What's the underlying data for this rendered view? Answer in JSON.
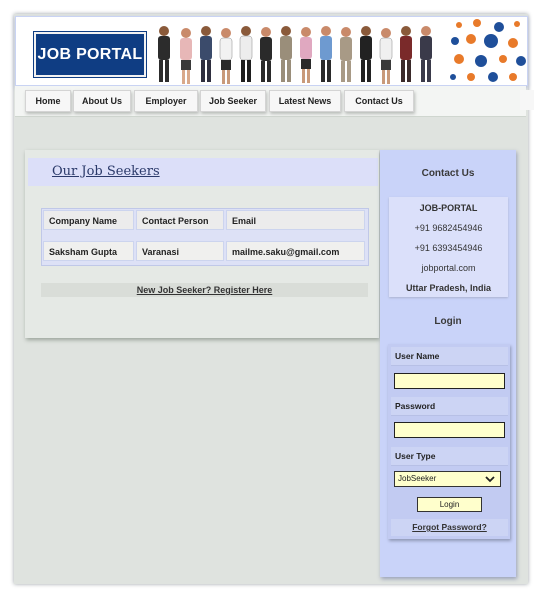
{
  "header": {
    "logo_text": "JOB PORTAL"
  },
  "nav": {
    "items": [
      {
        "label": "Home"
      },
      {
        "label": "About Us"
      },
      {
        "label": "Employer"
      },
      {
        "label": "Job Seeker"
      },
      {
        "label": "Latest News"
      },
      {
        "label": "Contact Us"
      }
    ]
  },
  "main": {
    "title": "Our Job Seekers",
    "table": {
      "headers": [
        "Company Name",
        "Contact Person",
        "Email"
      ],
      "rows": [
        [
          "Saksham Gupta",
          "Varanasi",
          "mailme.saku@gmail.com"
        ]
      ]
    },
    "register_link": "New Job Seeker? Register Here"
  },
  "sidebar": {
    "contact_heading": "Contact Us",
    "contact": {
      "name": "JOB-PORTAL",
      "phone1": "+91 9682454946",
      "phone2": "+91 6393454946",
      "website": "jobportal.com",
      "location": "Uttar Pradesh, India"
    },
    "login_heading": "Login",
    "login": {
      "username_label": "User Name",
      "username_value": "",
      "password_label": "Password",
      "password_value": "",
      "usertype_label": "User Type",
      "usertype_selected": "JobSeeker",
      "login_button": "Login",
      "forgot_link": "Forgot Password?"
    }
  },
  "colors": {
    "logo_bg": "#0f3d83",
    "sidebar_bg": "#c9d3f9",
    "input_bg": "#ffffcc",
    "page_bg": "#dfe3df"
  }
}
